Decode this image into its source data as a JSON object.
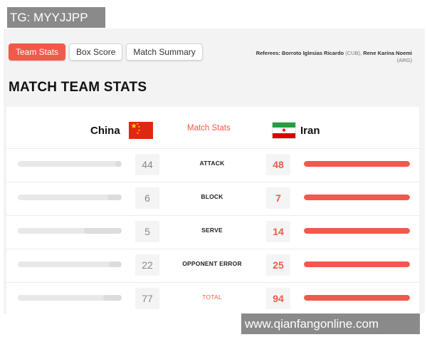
{
  "watermarks": {
    "top_left": "TG: MYYJJPP",
    "bottom_right": "www.qianfangonline.com"
  },
  "tabs": [
    {
      "label": "Team Stats",
      "active": true
    },
    {
      "label": "Box Score",
      "active": false
    },
    {
      "label": "Match Summary",
      "active": false
    }
  ],
  "referees": {
    "label": "Referees:",
    "name1": "Borroto Iglesias Ricardo",
    "country1": "(CUB),",
    "name2": "Rene Karina Noemi",
    "country2": "(ARG)"
  },
  "page_title": "MATCH TEAM STATS",
  "header": {
    "team_left": "China",
    "team_right": "Iran",
    "center_label": "Match Stats",
    "flag_left": "china-flag",
    "flag_right": "iran-flag"
  },
  "stats": [
    {
      "category": "ATTACK",
      "left": "44",
      "right": "48",
      "left_fill": 0.06,
      "right_fill": 1.0,
      "total": false
    },
    {
      "category": "BLOCK",
      "left": "6",
      "right": "7",
      "left_fill": 0.14,
      "right_fill": 1.0,
      "total": false
    },
    {
      "category": "SERVE",
      "left": "5",
      "right": "14",
      "left_fill": 0.36,
      "right_fill": 1.0,
      "total": false
    },
    {
      "category": "OPPONENT ERROR",
      "left": "22",
      "right": "25",
      "left_fill": 0.12,
      "right_fill": 1.0,
      "total": false
    },
    {
      "category": "TOTAL",
      "left": "77",
      "right": "94",
      "left_fill": 0.18,
      "right_fill": 1.0,
      "total": true
    }
  ],
  "colors": {
    "accent": "#f05a4a",
    "bar_right": "#ef5a4c",
    "bar_left_track": "#e8e8e8",
    "bar_left_fill": "#dcdcdc"
  }
}
